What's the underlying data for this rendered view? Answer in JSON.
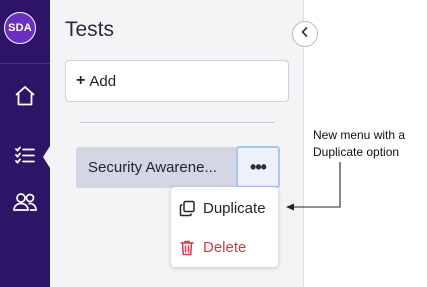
{
  "rail": {
    "logo_text": "SDA",
    "items": [
      {
        "name": "home-icon"
      },
      {
        "name": "list-icon",
        "active": true
      },
      {
        "name": "users-icon"
      }
    ]
  },
  "panel": {
    "title": "Tests",
    "add_label": "Add",
    "add_icon": "+",
    "test_item": {
      "label": "Security Awarene..."
    },
    "more_icon": "•••"
  },
  "menu": {
    "items": [
      {
        "label": "Duplicate",
        "icon": "copy-icon",
        "color": "#23232f"
      },
      {
        "label": "Delete",
        "icon": "trash-icon",
        "color": "#d13b4b"
      }
    ]
  },
  "annotation": {
    "line1": "New menu with a",
    "line2": "Duplicate option"
  },
  "colors": {
    "rail": "#2d1466",
    "logo": "#6a2fc0",
    "panel": "#f4f4f7",
    "delete": "#d13b4b"
  }
}
